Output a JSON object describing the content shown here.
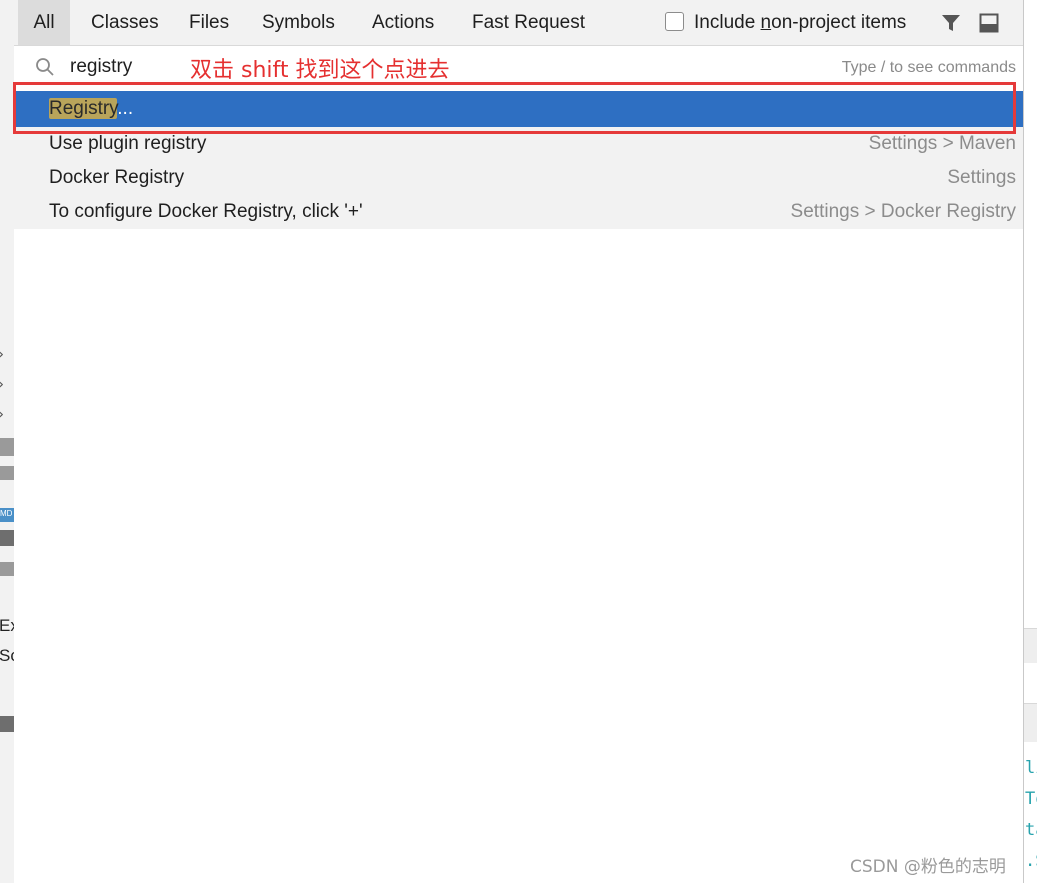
{
  "tabs": [
    {
      "label": "All",
      "active": true
    },
    {
      "label": "Classes",
      "active": false
    },
    {
      "label": "Files",
      "active": false
    },
    {
      "label": "Symbols",
      "active": false
    },
    {
      "label": "Actions",
      "active": false
    },
    {
      "label": "Fast Request",
      "active": false
    }
  ],
  "include_non_project": {
    "prefix": "Include ",
    "underlined": "n",
    "suffix": "on-project items",
    "checked": false
  },
  "toolbar_icons": [
    "filter-icon",
    "dock-panel-icon"
  ],
  "search": {
    "value": "registry",
    "hint": "Type / to see commands"
  },
  "annotation": "双击 shift 找到这个点进去",
  "results": [
    {
      "match": "Registry",
      "rest": "...",
      "location": "",
      "selected": true
    },
    {
      "match": "",
      "rest": "Use plugin registry",
      "location": "Settings > Maven",
      "selected": false
    },
    {
      "match": "",
      "rest": "Docker Registry",
      "location": "Settings",
      "selected": false
    },
    {
      "match": "",
      "rest": "To configure Docker Registry, click '+'",
      "location": "Settings > Docker Registry",
      "selected": false
    }
  ],
  "background_fragments": {
    "left": [
      "Ex",
      "Sc",
      "MD"
    ],
    "right": [
      "li",
      "To",
      "ta",
      ".S"
    ]
  },
  "watermark": "CSDN @粉色的志明",
  "colors": {
    "selection": "#2e6fc2",
    "match_highlight": "#b9a45a",
    "annotation_red": "#e53030",
    "tabbar_bg": "#f2f2f2"
  }
}
